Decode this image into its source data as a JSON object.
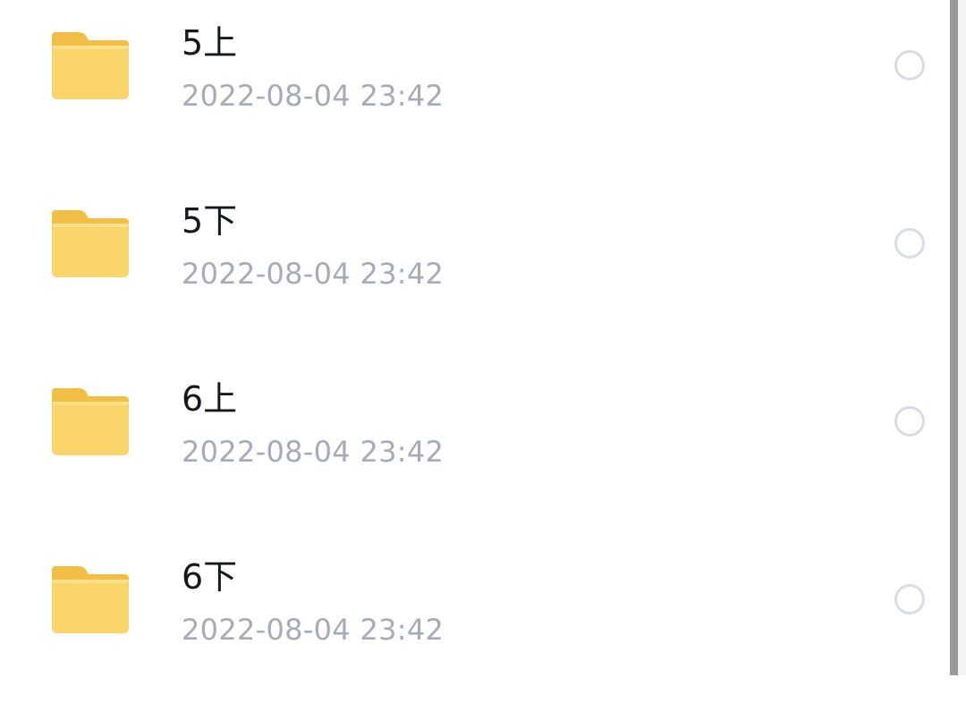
{
  "files": [
    {
      "name": "5上",
      "time": "2022-08-04 23:42",
      "icon": "folder-icon",
      "selected": false
    },
    {
      "name": "5下",
      "time": "2022-08-04 23:42",
      "icon": "folder-icon",
      "selected": false
    },
    {
      "name": "6上",
      "time": "2022-08-04 23:42",
      "icon": "folder-icon",
      "selected": false
    },
    {
      "name": "6下",
      "time": "2022-08-04 23:42",
      "icon": "folder-icon",
      "selected": false
    }
  ],
  "colors": {
    "folder_back": "#F2BE45",
    "folder_front": "#FAD56A",
    "name_text": "#15171D",
    "time_text": "#A7ABB8",
    "radio_border": "#D9DCE2"
  }
}
